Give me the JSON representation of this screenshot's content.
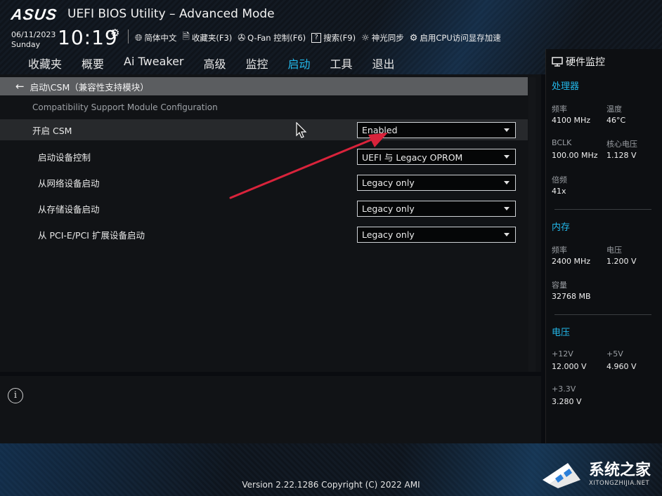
{
  "header": {
    "brand": "ASUS",
    "title": "UEFI BIOS Utility – Advanced Mode",
    "date": "06/11/2023",
    "weekday": "Sunday",
    "time": "10:19",
    "toolbar": [
      {
        "icon": "globe-icon",
        "label": "简体中文"
      },
      {
        "icon": "favorites-icon",
        "label": "收藏夹(F3)"
      },
      {
        "icon": "fan-icon",
        "label": "Q-Fan 控制(F6)"
      },
      {
        "icon": "help-icon",
        "label": "搜索(F9)"
      },
      {
        "icon": "light-icon",
        "label": "神光同步"
      },
      {
        "icon": "cpu-memory-icon",
        "label": "启用CPU访问显存加速"
      }
    ]
  },
  "tabs": [
    "收藏夹",
    "概要",
    "Ai Tweaker",
    "高级",
    "监控",
    "启动",
    "工具",
    "退出"
  ],
  "active_tab": "启动",
  "breadcrumb": "启动\\CSM（兼容性支持模块）",
  "section_title": "Compatibility Support Module Configuration",
  "settings": [
    {
      "label": "开启 CSM",
      "value": "Enabled"
    },
    {
      "label": "启动设备控制",
      "value": "UEFI 与 Legacy OPROM"
    },
    {
      "label": "从网络设备启动",
      "value": "Legacy only"
    },
    {
      "label": "从存储设备启动",
      "value": "Legacy only"
    },
    {
      "label": "从 PCI-E/PCI 扩展设备启动",
      "value": "Legacy only"
    }
  ],
  "hw_monitor": {
    "title": "硬件监控",
    "cpu": {
      "heading": "处理器",
      "freq_label": "频率",
      "freq": "4100 MHz",
      "temp_label": "温度",
      "temp": "46°C",
      "bclk_label": "BCLK",
      "bclk": "100.00 MHz",
      "vcore_label": "核心电压",
      "vcore": "1.128 V",
      "ratio_label": "倍频",
      "ratio": "41x"
    },
    "memory": {
      "heading": "内存",
      "freq_label": "频率",
      "freq": "2400 MHz",
      "volt_label": "电压",
      "volt": "1.200 V",
      "cap_label": "容量",
      "cap": "32768 MB"
    },
    "voltage": {
      "heading": "电压",
      "v12_label": "+12V",
      "v12": "12.000 V",
      "v5_label": "+5V",
      "v5": "4.960 V",
      "v33_label": "+3.3V",
      "v33": "3.280 V"
    }
  },
  "footer": {
    "version": "Version 2.22.1286 Copyright (C) 2022 AMI"
  },
  "watermark": {
    "name": "系统之家",
    "url": "XITONGZHIJIA.NET"
  },
  "colors": {
    "accent": "#23b8ea",
    "annotation_arrow": "#d9233b"
  }
}
